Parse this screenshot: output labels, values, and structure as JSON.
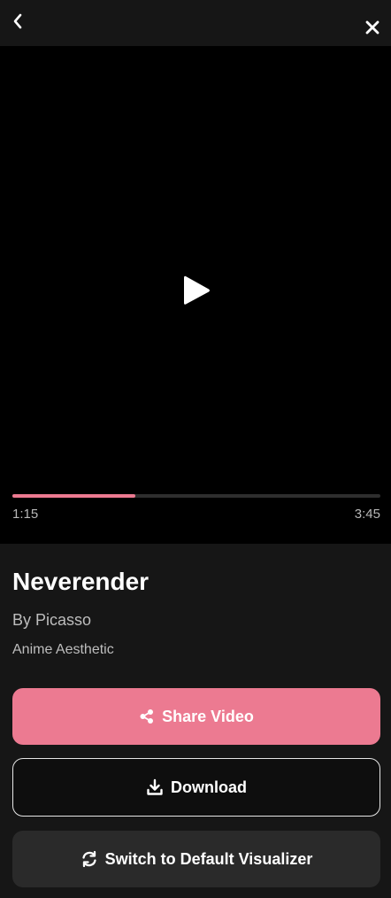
{
  "player": {
    "progress_fraction": 0.333,
    "current_time": "1:15",
    "total_time": "3:45"
  },
  "track": {
    "title": "Neverender",
    "artist": "By Picasso",
    "style": "Anime Aesthetic"
  },
  "actions": {
    "share_label": "Share Video",
    "download_label": "Download",
    "switch_label": "Switch to Default Visualizer"
  },
  "icons": {
    "back": "chevron-left-icon",
    "close": "close-icon",
    "play": "play-icon",
    "share": "share-icon",
    "download": "download-icon",
    "switch": "refresh-icon"
  },
  "colors": {
    "accent": "#ec7a91",
    "background": "#161616",
    "player_background": "#000000",
    "secondary_button": "#2a2a2a"
  }
}
